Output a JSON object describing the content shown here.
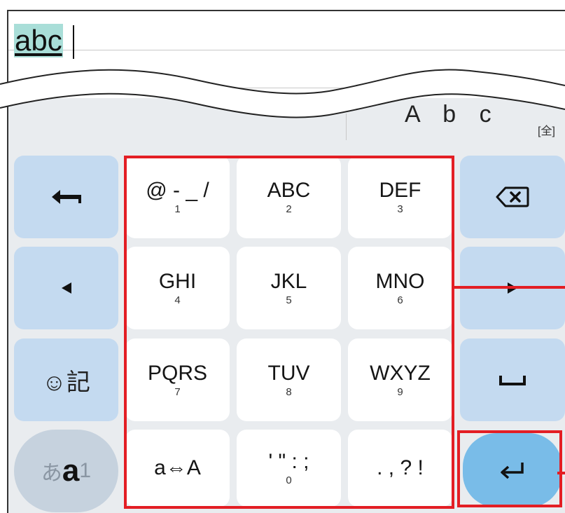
{
  "text_area": {
    "typed_text": "abc"
  },
  "candidate_bar": {
    "candidate": "A b c",
    "width_mode": "[全]"
  },
  "keys": {
    "undo": {
      "icon": "undo-arrow-icon"
    },
    "left": {
      "icon": "triangle-left-icon"
    },
    "emoji": {
      "label": "☺記"
    },
    "mode": {
      "label_a": "あ",
      "label_b": "a",
      "label_c": "1"
    },
    "k1": {
      "letters": "@ - _ /",
      "digit": "1"
    },
    "k2": {
      "letters": "ABC",
      "digit": "2"
    },
    "k3": {
      "letters": "DEF",
      "digit": "3"
    },
    "k4": {
      "letters": "GHI",
      "digit": "4"
    },
    "k5": {
      "letters": "JKL",
      "digit": "5"
    },
    "k6": {
      "letters": "MNO",
      "digit": "6"
    },
    "k7": {
      "letters": "PQRS",
      "digit": "7"
    },
    "k8": {
      "letters": "TUV",
      "digit": "8"
    },
    "k9": {
      "letters": "WXYZ",
      "digit": "9"
    },
    "case": {
      "label": "a⇔A"
    },
    "k0": {
      "letters": "' \" : ;",
      "digit": "0"
    },
    "punct": {
      "label": ". , ? !"
    },
    "backspace": {
      "icon": "backspace-icon"
    },
    "right": {
      "icon": "triangle-right-icon"
    },
    "space": {
      "icon": "space-icon"
    },
    "enter": {
      "icon": "enter-icon"
    }
  },
  "colors": {
    "highlight": "#e31e24",
    "enter_key": "#79bce8",
    "function_key": "#c4daf0"
  }
}
